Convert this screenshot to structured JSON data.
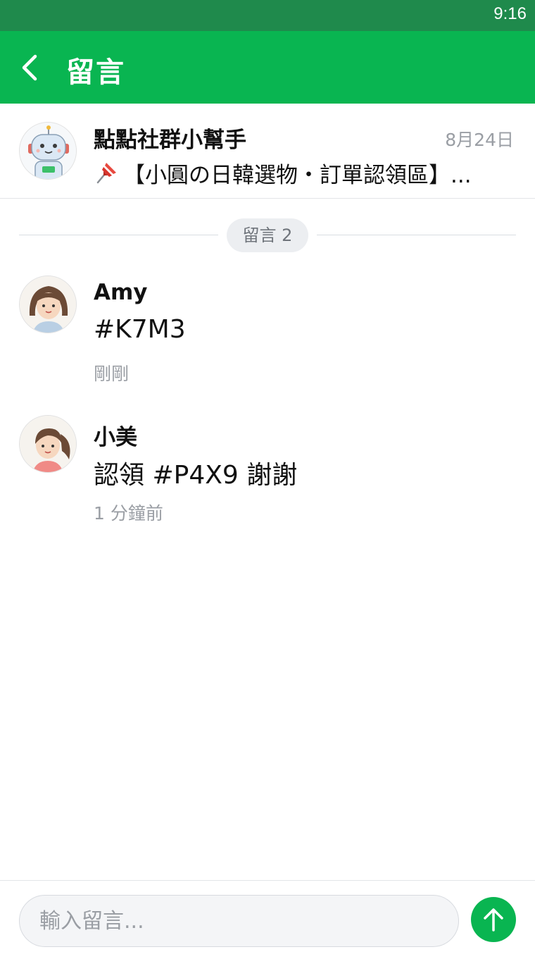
{
  "status_bar": {
    "time": "9:16"
  },
  "header": {
    "title": "留言"
  },
  "post": {
    "author": "點點社群小幫手",
    "date": "8月24日",
    "preview": "【小圓の日韓選物・訂單認領區】..."
  },
  "divider": {
    "label": "留言 2"
  },
  "comments": [
    {
      "name": "Amy",
      "text": "#K7M3",
      "time": "剛剛"
    },
    {
      "name": "小美",
      "text": "認領 #P4X9 謝謝",
      "time": "1 分鐘前"
    }
  ],
  "input": {
    "placeholder": "輸入留言..."
  },
  "colors": {
    "brand_green": "#09b551",
    "status_bar": "#1f8a4c"
  },
  "icons": {
    "back": "chevron-left-icon",
    "pin": "pushpin-icon",
    "send": "arrow-up-icon"
  }
}
